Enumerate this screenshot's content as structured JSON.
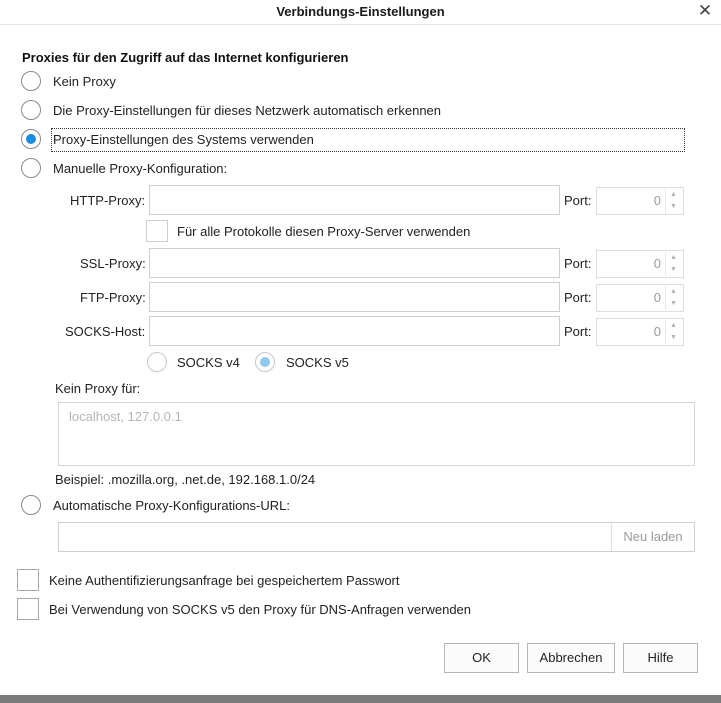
{
  "window": {
    "title": "Verbindungs-Einstellungen"
  },
  "section_heading": "Proxies für den Zugriff auf das Internet konfigurieren",
  "proxy_modes": [
    {
      "label": "Kein Proxy",
      "selected": false
    },
    {
      "label": "Die Proxy-Einstellungen für dieses Netzwerk automatisch erkennen",
      "selected": false
    },
    {
      "label": "Proxy-Einstellungen des Systems verwenden",
      "selected": true
    },
    {
      "label": "Manuelle Proxy-Konfiguration:",
      "selected": false
    }
  ],
  "manual": {
    "http_label": "HTTP-Proxy:",
    "http_value": "",
    "port_label": "Port:",
    "http_port": "0",
    "all_protocols_label": "Für alle Protokolle diesen Proxy-Server verwenden",
    "ssl_label": "SSL-Proxy:",
    "ssl_port": "0",
    "ftp_label": "FTP-Proxy:",
    "ftp_port": "0",
    "socks_label": "SOCKS-Host:",
    "socks_port": "0",
    "socks_v4_label": "SOCKS v4",
    "socks_v5_label": "SOCKS v5",
    "socks_version_selected": "SOCKS v5"
  },
  "no_proxy": {
    "label": "Kein Proxy für:",
    "placeholder": "localhost, 127.0.0.1",
    "example": "Beispiel: .mozilla.org, .net.de, 192.168.1.0/24"
  },
  "auto_url": {
    "label": "Automatische Proxy-Konfigurations-URL:",
    "value": "",
    "reload_label": "Neu laden"
  },
  "options": [
    {
      "label": "Keine Authentifizierungsanfrage bei gespeichertem Passwort",
      "checked": false
    },
    {
      "label": "Bei Verwendung von SOCKS v5 den Proxy für DNS-Anfragen verwenden",
      "checked": false
    }
  ],
  "buttons": {
    "ok": "OK",
    "cancel": "Abbrechen",
    "help": "Hilfe"
  },
  "colors": {
    "accent": "#1a8de0",
    "disabled_text": "#9a9a9a"
  }
}
